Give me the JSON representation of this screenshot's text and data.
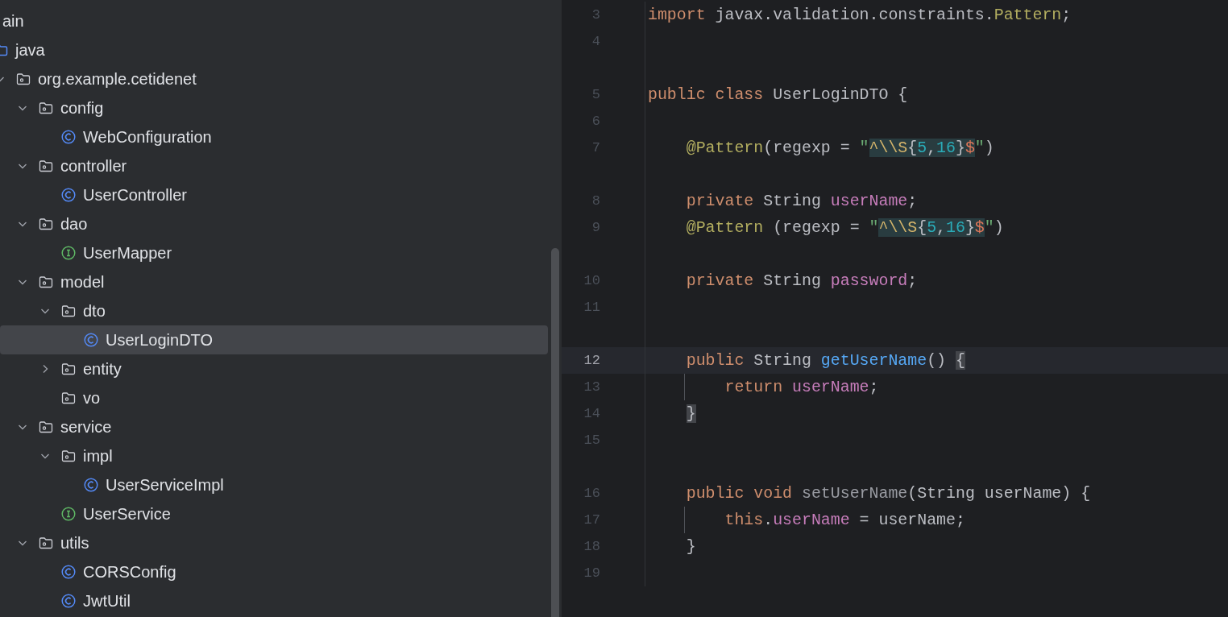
{
  "project_tree": [
    {
      "label": "ain",
      "selected": false,
      "children": [
        {
          "label": "java",
          "kind": "source-root",
          "selected": false,
          "children": [
            {
              "label": "org.example.cetidenet",
              "kind": "package",
              "expanded": true,
              "selected": false,
              "children": [
                {
                  "label": "config",
                  "kind": "package",
                  "expanded": true,
                  "selected": false,
                  "children": [
                    {
                      "label": "WebConfiguration",
                      "kind": "class",
                      "selected": false
                    }
                  ]
                },
                {
                  "label": "controller",
                  "kind": "package",
                  "expanded": true,
                  "selected": false,
                  "children": [
                    {
                      "label": "UserController",
                      "kind": "class",
                      "selected": false
                    }
                  ]
                },
                {
                  "label": "dao",
                  "kind": "package",
                  "expanded": true,
                  "selected": false,
                  "children": [
                    {
                      "label": "UserMapper",
                      "kind": "interface",
                      "selected": false
                    }
                  ]
                },
                {
                  "label": "model",
                  "kind": "package",
                  "expanded": true,
                  "selected": false,
                  "children": [
                    {
                      "label": "dto",
                      "kind": "package",
                      "expanded": true,
                      "selected": false,
                      "children": [
                        {
                          "label": "UserLoginDTO",
                          "kind": "class",
                          "selected": true
                        }
                      ]
                    },
                    {
                      "label": "entity",
                      "kind": "package",
                      "expanded": false,
                      "selected": false
                    },
                    {
                      "label": "vo",
                      "kind": "package",
                      "selected": false
                    }
                  ]
                },
                {
                  "label": "service",
                  "kind": "package",
                  "expanded": true,
                  "selected": false,
                  "children": [
                    {
                      "label": "impl",
                      "kind": "package",
                      "expanded": true,
                      "selected": false,
                      "children": [
                        {
                          "label": "UserServiceImpl",
                          "kind": "class",
                          "selected": false
                        }
                      ]
                    },
                    {
                      "label": "UserService",
                      "kind": "interface",
                      "selected": false
                    }
                  ]
                },
                {
                  "label": "utils",
                  "kind": "package",
                  "expanded": true,
                  "selected": false,
                  "children": [
                    {
                      "label": "CORSConfig",
                      "kind": "class",
                      "selected": false
                    },
                    {
                      "label": "JwtUtil",
                      "kind": "class",
                      "selected": false
                    }
                  ]
                }
              ]
            }
          ]
        }
      ]
    }
  ],
  "editor": {
    "lines": [
      {
        "kind": "code",
        "number": "3",
        "current": false,
        "tokens": [
          {
            "text": "import",
            "kind": "keyword"
          },
          {
            "text": " javax.validation.constraints.",
            "kind": "plain"
          },
          {
            "text": "Pattern",
            "kind": "annotation"
          },
          {
            "text": ";",
            "kind": "plain"
          }
        ]
      },
      {
        "kind": "code",
        "number": "4",
        "current": false
      },
      {
        "kind": "gap"
      },
      {
        "kind": "code",
        "number": "5",
        "current": false,
        "tokens": [
          {
            "text": "public class",
            "kind": "keyword"
          },
          {
            "text": " UserLoginDTO {",
            "kind": "plain"
          }
        ],
        "children": [
          {
            "kind": "code",
            "number": "6",
            "current": false
          },
          {
            "kind": "code",
            "number": "7",
            "current": false,
            "tokens": [
              {
                "text": "@Pattern",
                "kind": "annotation"
              },
              {
                "text": "(regexp = ",
                "kind": "plain"
              },
              {
                "text": "\"",
                "kind": "string"
              },
              {
                "text": "^",
                "kind": "regex-anchor",
                "injected": true
              },
              {
                "text": "\\\\S",
                "kind": "regex-escape",
                "injected": true
              },
              {
                "text": "{",
                "kind": "plain",
                "injected": true
              },
              {
                "text": "5",
                "kind": "regex-number",
                "injected": true
              },
              {
                "text": ",",
                "kind": "plain",
                "injected": true
              },
              {
                "text": "16",
                "kind": "regex-number",
                "injected": true
              },
              {
                "text": "}",
                "kind": "plain",
                "injected": true
              },
              {
                "text": "$",
                "kind": "regex-end",
                "injected": true
              },
              {
                "text": "\"",
                "kind": "string"
              },
              {
                "text": ")",
                "kind": "plain"
              }
            ]
          },
          {
            "kind": "gap"
          },
          {
            "kind": "code",
            "number": "8",
            "current": false,
            "tokens": [
              {
                "text": "private",
                "kind": "keyword"
              },
              {
                "text": " String ",
                "kind": "plain"
              },
              {
                "text": "userName",
                "kind": "field"
              },
              {
                "text": ";",
                "kind": "plain"
              }
            ]
          },
          {
            "kind": "code",
            "number": "9",
            "current": false,
            "tokens": [
              {
                "text": "@Pattern",
                "kind": "annotation"
              },
              {
                "text": " (regexp = ",
                "kind": "plain"
              },
              {
                "text": "\"",
                "kind": "string"
              },
              {
                "text": "^",
                "kind": "regex-anchor",
                "injected": true
              },
              {
                "text": "\\\\S",
                "kind": "regex-escape",
                "injected": true
              },
              {
                "text": "{",
                "kind": "plain",
                "injected": true
              },
              {
                "text": "5",
                "kind": "regex-number",
                "injected": true
              },
              {
                "text": ",",
                "kind": "plain",
                "injected": true
              },
              {
                "text": "16",
                "kind": "regex-number",
                "injected": true
              },
              {
                "text": "}",
                "kind": "plain",
                "injected": true
              },
              {
                "text": "$",
                "kind": "regex-end",
                "injected": true
              },
              {
                "text": "\"",
                "kind": "string"
              },
              {
                "text": ")",
                "kind": "plain"
              }
            ]
          },
          {
            "kind": "gap"
          },
          {
            "kind": "code",
            "number": "10",
            "current": false,
            "tokens": [
              {
                "text": "private",
                "kind": "keyword"
              },
              {
                "text": " String ",
                "kind": "plain"
              },
              {
                "text": "password",
                "kind": "field"
              },
              {
                "text": ";",
                "kind": "plain"
              }
            ]
          },
          {
            "kind": "code",
            "number": "11",
            "current": false
          },
          {
            "kind": "gap"
          },
          {
            "kind": "code",
            "number": "12",
            "current": true,
            "tokens": [
              {
                "text": "public",
                "kind": "keyword"
              },
              {
                "text": " String ",
                "kind": "plain"
              },
              {
                "text": "getUserName",
                "kind": "method-decl"
              },
              {
                "text": "() ",
                "kind": "plain"
              },
              {
                "text": "{",
                "kind": "plain",
                "matched": true
              }
            ],
            "children": [
              {
                "kind": "code",
                "number": "13",
                "current": false,
                "guide": true,
                "tokens": [
                  {
                    "text": "return ",
                    "kind": "keyword"
                  },
                  {
                    "text": "userName",
                    "kind": "field"
                  },
                  {
                    "text": ";",
                    "kind": "plain"
                  }
                ]
              }
            ]
          },
          {
            "kind": "code",
            "number": "14",
            "current": false,
            "tokens": [
              {
                "text": "}",
                "kind": "plain",
                "matched": true
              }
            ]
          },
          {
            "kind": "code",
            "number": "15",
            "current": false
          },
          {
            "kind": "gap"
          },
          {
            "kind": "code",
            "number": "16",
            "current": false,
            "tokens": [
              {
                "text": "public void ",
                "kind": "keyword"
              },
              {
                "text": "setUserName",
                "kind": "method-unused"
              },
              {
                "text": "(String userName) {",
                "kind": "plain"
              }
            ],
            "children": [
              {
                "kind": "code",
                "number": "17",
                "current": false,
                "guide": true,
                "tokens": [
                  {
                    "text": "this",
                    "kind": "keyword"
                  },
                  {
                    "text": ".",
                    "kind": "plain"
                  },
                  {
                    "text": "userName",
                    "kind": "field"
                  },
                  {
                    "text": " = userName;",
                    "kind": "plain"
                  }
                ]
              }
            ]
          },
          {
            "kind": "code",
            "number": "18",
            "current": false,
            "tokens": [
              {
                "text": "}",
                "kind": "plain"
              }
            ]
          },
          {
            "kind": "code",
            "number": "19",
            "current": false
          }
        ]
      }
    ]
  }
}
